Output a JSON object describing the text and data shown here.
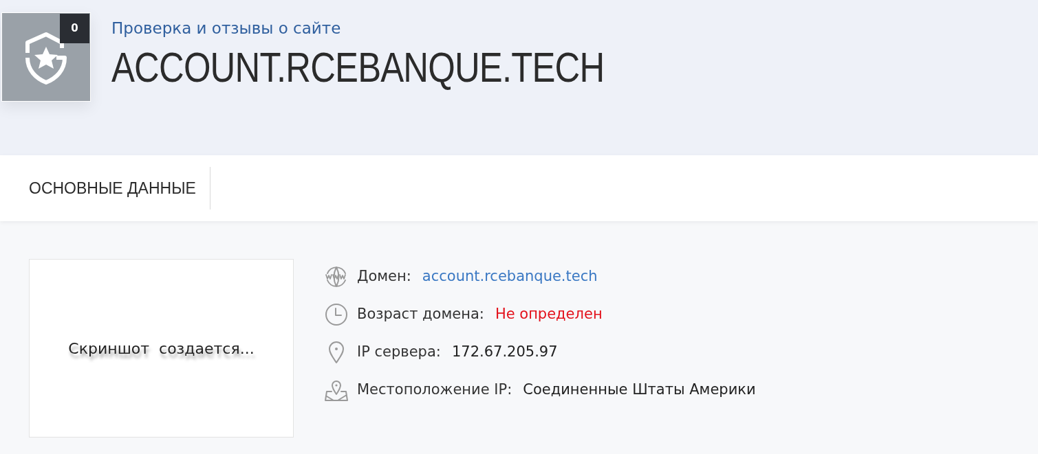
{
  "header": {
    "badge": "0",
    "subtitle": "Проверка и отзывы о сайте",
    "title": "ACCOUNT.RCEBANQUE.TECH"
  },
  "tabs": [
    {
      "label": "ОСНОВНЫЕ ДАННЫЕ",
      "selected": true
    }
  ],
  "screenshot": {
    "text": "Скриншот  создается..."
  },
  "details": [
    {
      "label": "Домен:",
      "value": "account.rcebanque.tech",
      "kind": "link"
    },
    {
      "label": "Возраст домена:",
      "value": "Не определен",
      "kind": "alert"
    },
    {
      "label": "IP сервера:",
      "value": "172.67.205.97",
      "kind": "plain"
    },
    {
      "label": "Местоположение IP:",
      "value": "Соединенные Штаты Америки",
      "kind": "plain"
    }
  ]
}
